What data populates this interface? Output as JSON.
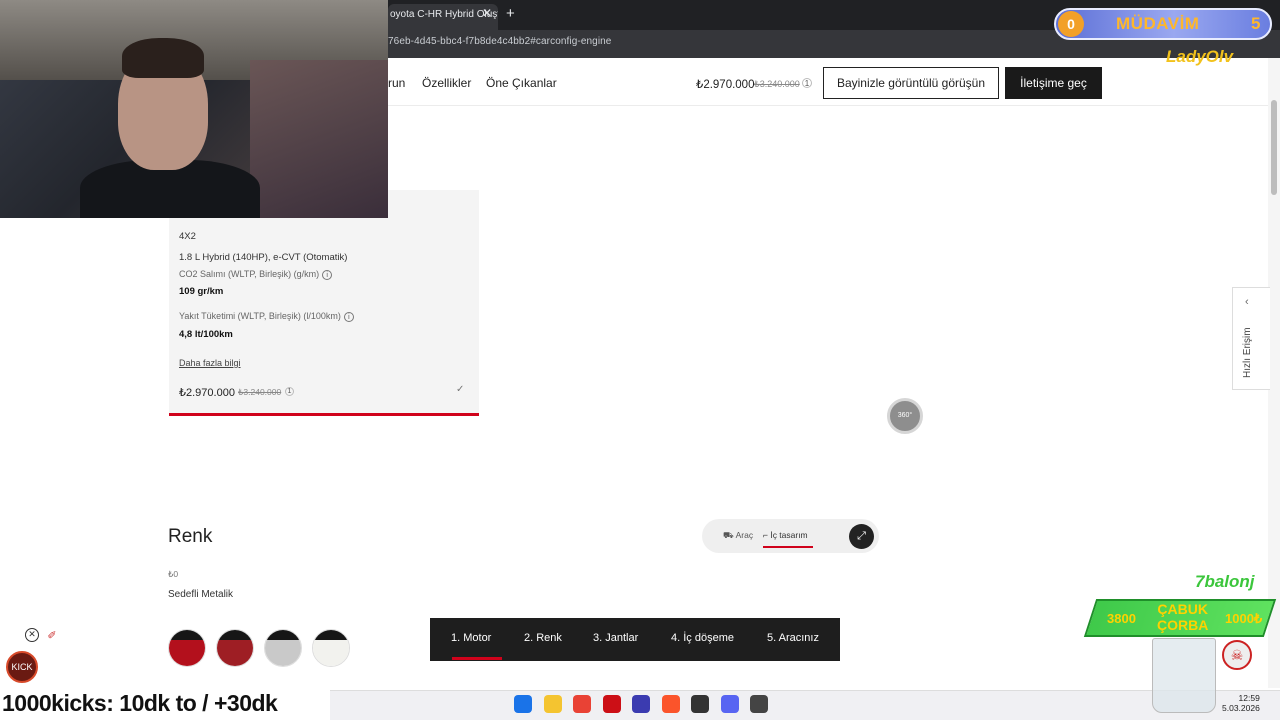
{
  "browser": {
    "tab_title": "oyota C-HR Hybrid Oluştu",
    "tab_close": "✕",
    "new_tab": "+",
    "url": "76eb-4d45-bbc4-f7b8de4c4bb2#carconfig-engine"
  },
  "page_nav": {
    "links": [
      "run",
      "Özellikler",
      "Öne Çıkanlar"
    ],
    "price": "₺2.970.000",
    "price_old": "₺3.240.000",
    "price_badge": "1",
    "video_button": "Bayinizle görüntülü görüşün",
    "contact_button": "İletişime geç"
  },
  "engine_card": {
    "drive": "4X2",
    "engine": "1.8 L Hybrid (140HP), e-CVT (Otomatik)",
    "co2_label": "CO2 Salımı (WLTP, Birleşik) (g/km)",
    "co2_value": "109 gr/km",
    "fuel_label": "Yakıt Tüketimi (WLTP, Birleşik) (l/100km)",
    "fuel_value": "4,8 lt/100km",
    "more_info": "Daha fazla bilgi",
    "price": "₺2.970.000",
    "price_old": "₺3.240.000",
    "price_badge": "1",
    "info_glyph": "i",
    "check_glyph": "✓"
  },
  "viewer": {
    "rotate_label": "360°",
    "toggle_car": "Araç",
    "toggle_interior": "İç tasarım",
    "expand_glyph": "⤢"
  },
  "quick_access": {
    "label": "Hızlı Erişim",
    "chevron": "‹"
  },
  "color_section": {
    "title": "Renk",
    "price": "₺0",
    "selected_name": "Sedefli Metalik",
    "swatches": [
      {
        "color": "#b3101c"
      },
      {
        "color": "#9e1e24"
      },
      {
        "color": "#c9c9c9"
      },
      {
        "color": "#f2f2ee"
      }
    ]
  },
  "steps": [
    "1. Motor",
    "2. Renk",
    "3. Jantlar",
    "4. İç döşeme",
    "5. Aracınız"
  ],
  "taskbar": {
    "time": "12:59",
    "date": "5.03.2026",
    "icons": [
      {
        "name": "windows-start-icon",
        "color": "#1a73e8"
      },
      {
        "name": "file-explorer-icon",
        "color": "#f4c430"
      },
      {
        "name": "chrome-icon",
        "color": "#e94235"
      },
      {
        "name": "opera-icon",
        "color": "#cc0f16"
      },
      {
        "name": "app-f-icon",
        "color": "#3b3bb0"
      },
      {
        "name": "brave-icon",
        "color": "#fb542b"
      },
      {
        "name": "chatgpt-icon",
        "color": "#333333"
      },
      {
        "name": "discord-icon",
        "color": "#5865f2"
      },
      {
        "name": "obs-icon",
        "color": "#444444"
      }
    ]
  },
  "overlays": {
    "badge_count": "0",
    "badge_title": "MÜDAVİM",
    "badge_number": "5",
    "username": "LadyOlv",
    "donor": "7balonj",
    "goal_title_1": "ÇABUK",
    "goal_title_2": "ÇORBA",
    "goal_current": "3800",
    "goal_target": "1000₺",
    "ticker": "1000kicks: 10dk to / +30dk",
    "mini_close": "✕",
    "mini_icon": "✐",
    "mini_logo": "KICK",
    "skull_glyph": "☠"
  }
}
